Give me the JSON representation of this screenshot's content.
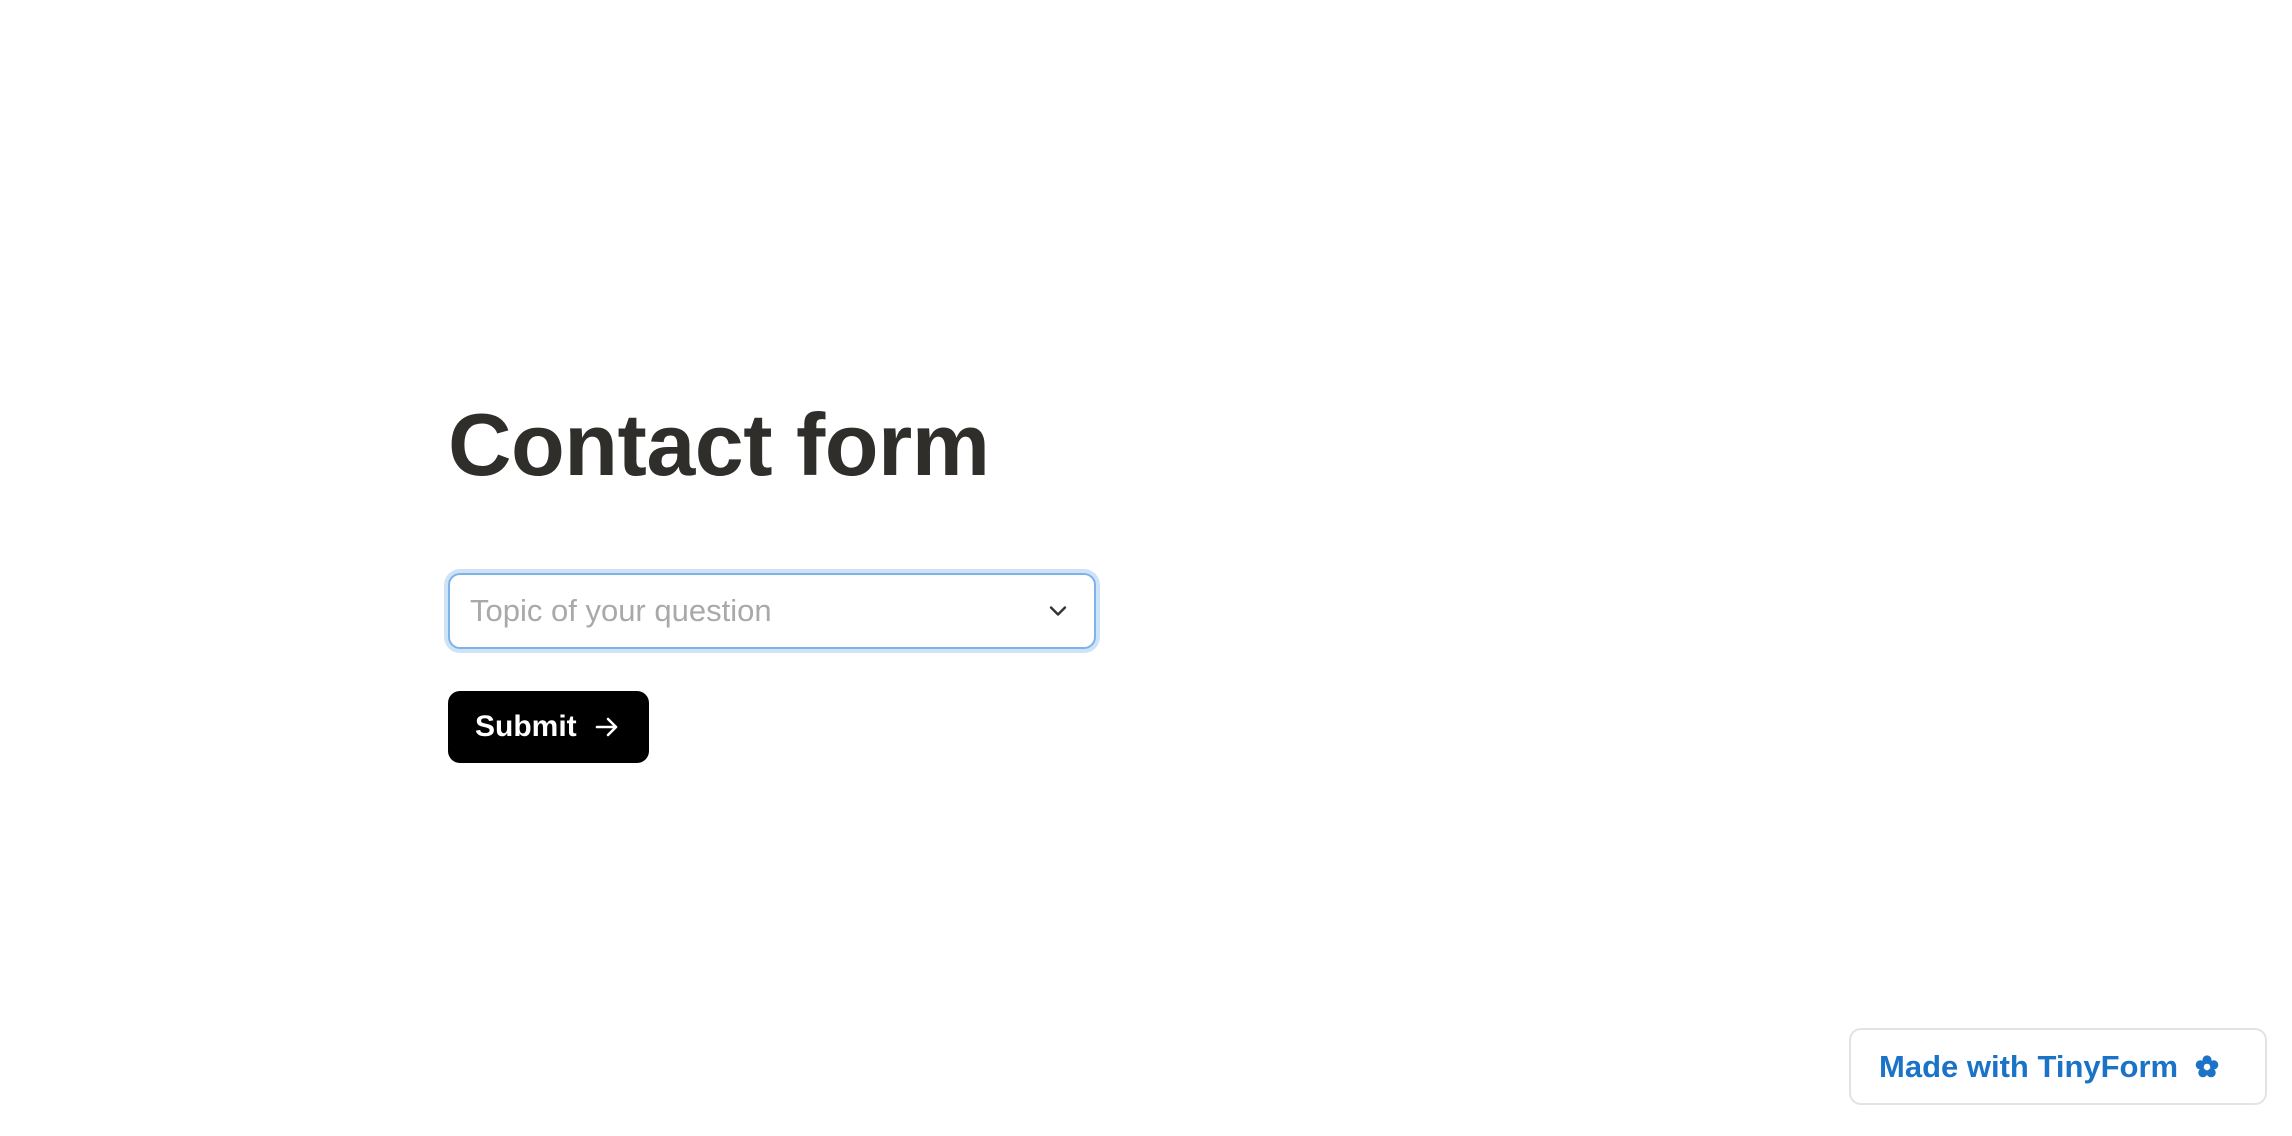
{
  "form": {
    "title": "Contact form",
    "topic_select": {
      "placeholder": "Topic of your question",
      "icon": "chevron-down-icon"
    },
    "submit": {
      "label": "Submit",
      "icon": "arrow-right-icon"
    }
  },
  "badge": {
    "label": "Made with TinyForm",
    "icon": "flower-icon"
  },
  "colors": {
    "title": "#2f2e2a",
    "focus_ring": "#7fb2e8",
    "button_bg": "#000000",
    "badge_text": "#1a73c6"
  }
}
